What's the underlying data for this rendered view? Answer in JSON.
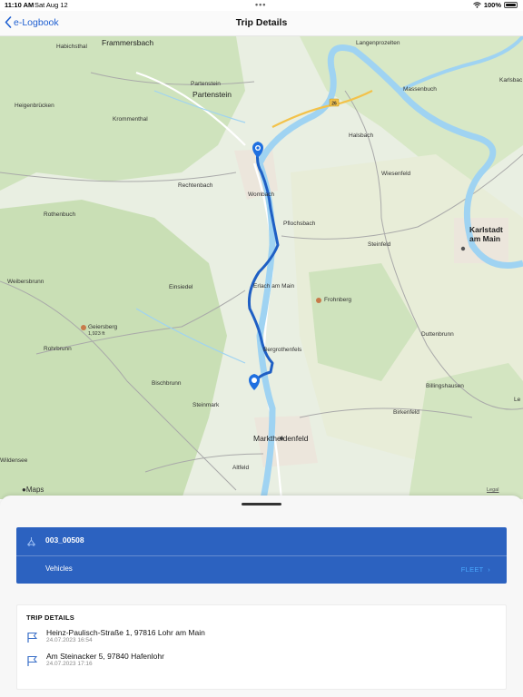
{
  "status_bar": {
    "time": "11:10 AM",
    "date": "Sat Aug 12",
    "battery": "100%"
  },
  "nav": {
    "back_label": "e-Logbook",
    "title": "Trip Details"
  },
  "map": {
    "attribution": "Maps",
    "legal": "Legal",
    "road_number": "26",
    "places": [
      {
        "name": "Frammersbach",
        "size": "big"
      },
      {
        "name": "Habichsthal",
        "size": "small"
      },
      {
        "name": "Partenstein",
        "size": "small"
      },
      {
        "name": "Partenstein",
        "size": "big"
      },
      {
        "name": "Heigenbrücken",
        "size": "small"
      },
      {
        "name": "Krommenthal",
        "size": "small"
      },
      {
        "name": "Langenprozelten",
        "size": "small"
      },
      {
        "name": "Massenbuch",
        "size": "small"
      },
      {
        "name": "Karlsbac",
        "size": "small"
      },
      {
        "name": "Halsbach",
        "size": "small"
      },
      {
        "name": "Wiesenfeld",
        "size": "small"
      },
      {
        "name": "Rechtenbach",
        "size": "small"
      },
      {
        "name": "Wombach",
        "size": "small"
      },
      {
        "name": "Pflochsbach",
        "size": "small"
      },
      {
        "name": "Rothenbuch",
        "size": "small"
      },
      {
        "name": "Steinfeld",
        "size": "small"
      },
      {
        "name": "Karlstadt",
        "size": "city"
      },
      {
        "name": "am Main",
        "size": "city"
      },
      {
        "name": "Weibersbrunn",
        "size": "small"
      },
      {
        "name": "Einsiedel",
        "size": "small"
      },
      {
        "name": "Erlach am Main",
        "size": "small"
      },
      {
        "name": "Frohnberg",
        "size": "small"
      },
      {
        "name": "Geiersberg",
        "size": "small"
      },
      {
        "name": "1,923 ft",
        "size": "tiny"
      },
      {
        "name": "Rohrbrunn",
        "size": "small"
      },
      {
        "name": "Bergrothenfels",
        "size": "small"
      },
      {
        "name": "Duttenbrunn",
        "size": "small"
      },
      {
        "name": "Billingshausen",
        "size": "small"
      },
      {
        "name": "Bischbrunn",
        "size": "small"
      },
      {
        "name": "Steinmark",
        "size": "small"
      },
      {
        "name": "Birkenfeld",
        "size": "small"
      },
      {
        "name": "Le",
        "size": "small"
      },
      {
        "name": "Marktheidenfeld",
        "size": "big"
      },
      {
        "name": "Wildensee",
        "size": "small"
      },
      {
        "name": "Altfeld",
        "size": "small"
      }
    ]
  },
  "vehicle": {
    "id": "003_00508",
    "label": "Vehicles",
    "action": "FLEET"
  },
  "trip": {
    "heading": "TRIP DETAILS",
    "stops": [
      {
        "address": "Heinz-Paulisch-Straße 1, 97816 Lohr am Main",
        "timestamp": "24.07.2023 16:54"
      },
      {
        "address": "Am Steinacker 5, 97840 Hafenlohr",
        "timestamp": "24.07.2023 17:16"
      }
    ]
  },
  "colors": {
    "accent": "#1e5fd1",
    "card_blue": "#2c62c0",
    "route": "#1f5fc4",
    "river": "#9fd3f2"
  }
}
